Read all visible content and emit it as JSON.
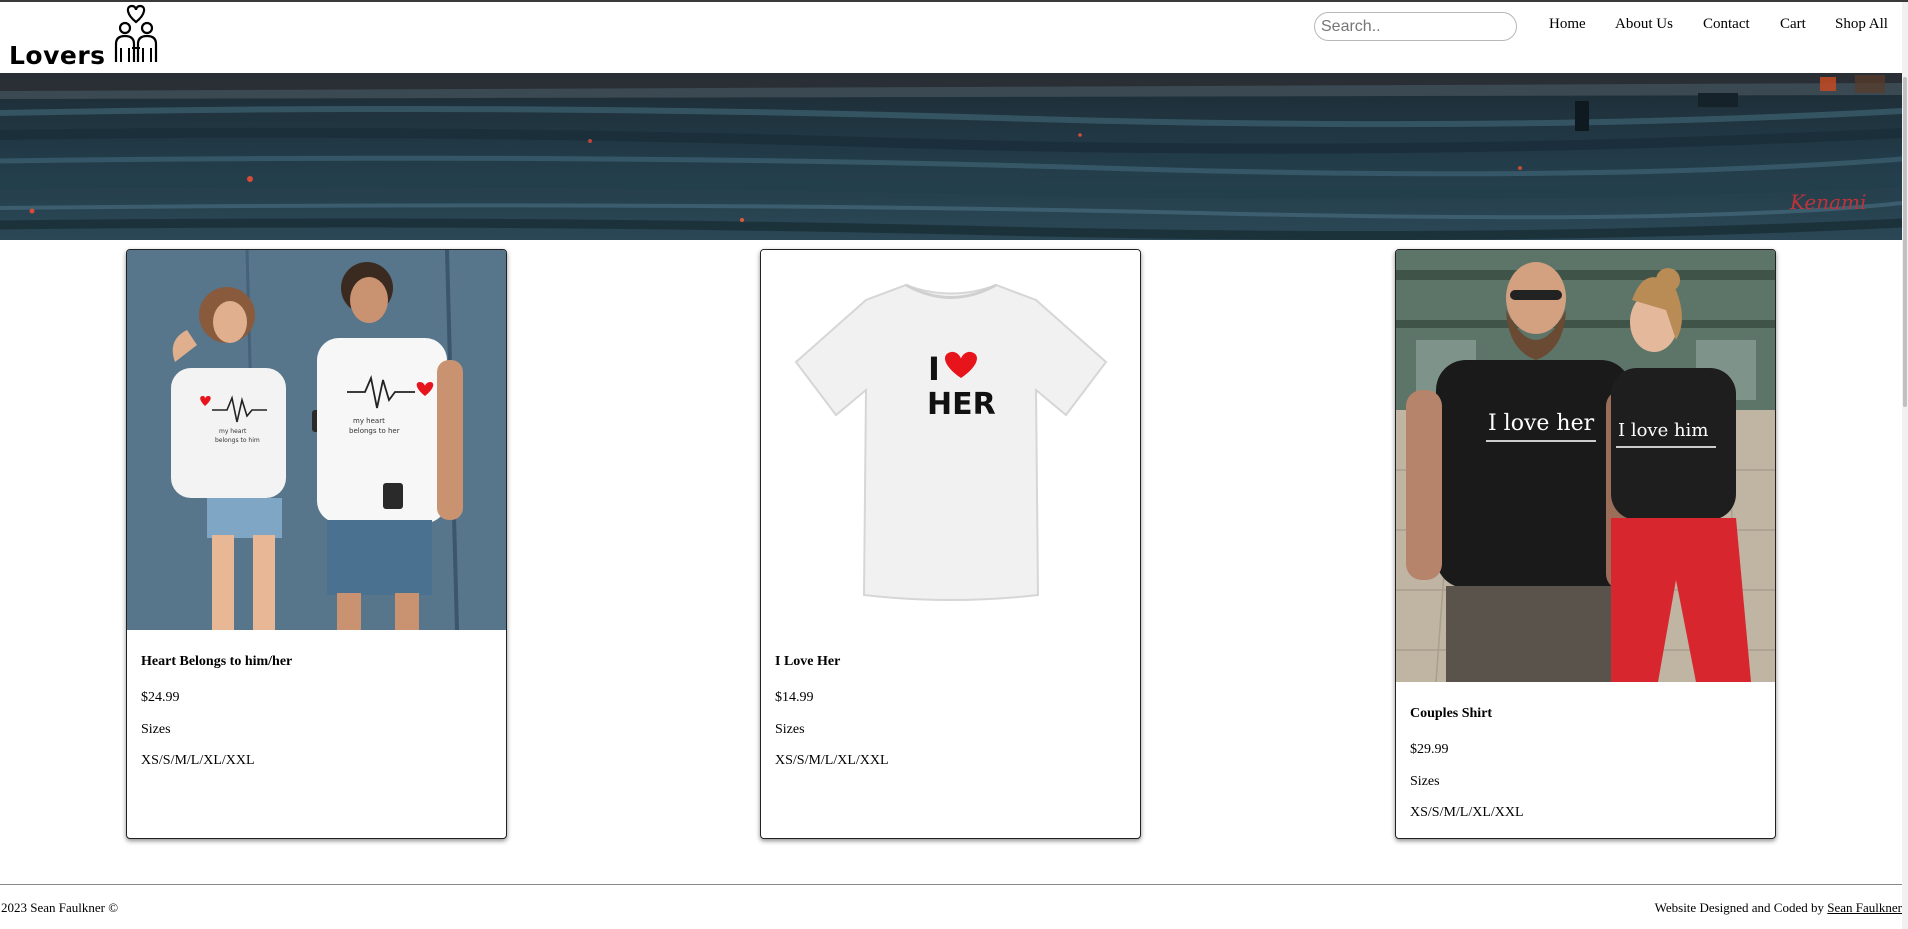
{
  "header": {
    "brand": "Lovers",
    "search_placeholder": "Search..",
    "nav": [
      "Home",
      "About Us",
      "Contact",
      "Cart",
      "Shop All"
    ]
  },
  "banner": {
    "signature": "Kenami"
  },
  "products": [
    {
      "name": "Heart Belongs to him/her",
      "price": "$24.99",
      "sizes_label": "Sizes",
      "sizes": "XS/S/M/L/XL/XXL"
    },
    {
      "name": "I Love Her",
      "price": "$14.99",
      "sizes_label": "Sizes",
      "sizes": "XS/S/M/L/XL/XXL",
      "shirt_text_top": "I",
      "shirt_text_bottom": "HER"
    },
    {
      "name": "Couples Shirt",
      "price": "$29.99",
      "sizes_label": "Sizes",
      "sizes": "XS/S/M/L/XL/XXL",
      "shirt_text_left": "I love her",
      "shirt_text_right": "I love him"
    }
  ],
  "footer": {
    "copyright": "2023 Sean Faulkner ©",
    "credit_prefix": "Website Designed and Coded by",
    "credit_link": "Sean Faulkner"
  },
  "colors": {
    "heart_red": "#e8141c",
    "banner_dark": "#1f3440",
    "pants_red": "#d8262e"
  }
}
